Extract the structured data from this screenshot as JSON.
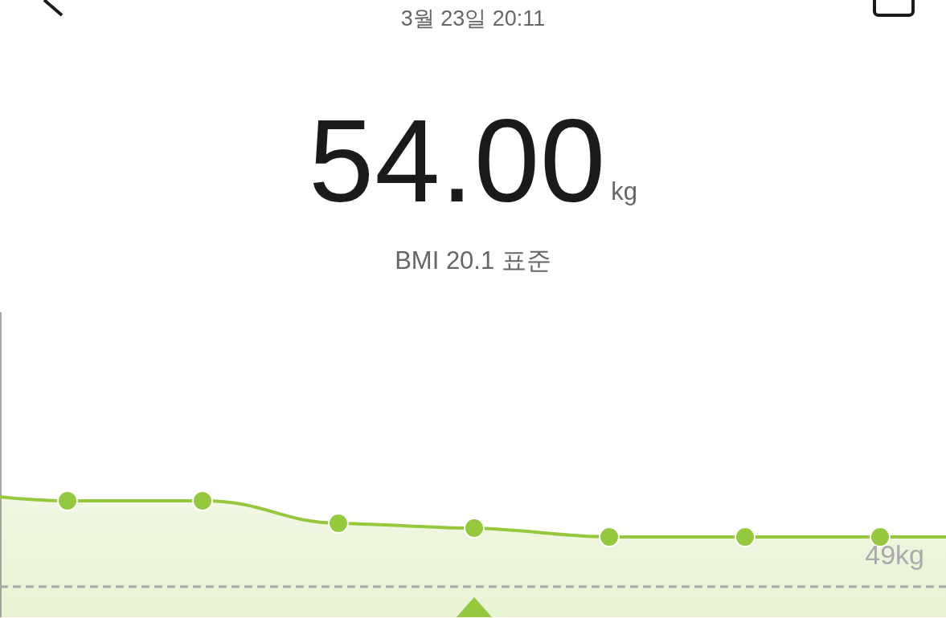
{
  "header": {
    "date": "3월 23일 20:11"
  },
  "measurement": {
    "value": "54.00",
    "unit": "kg",
    "bmi": "BMI 20.1 표준"
  },
  "trend": {
    "reference_label": "49kg"
  }
}
